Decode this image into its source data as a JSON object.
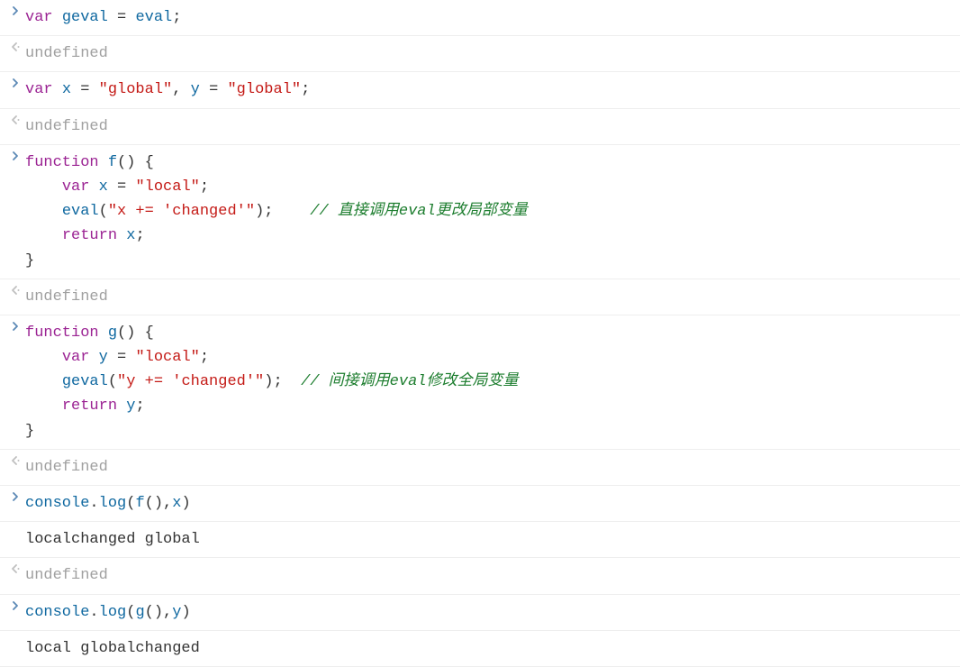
{
  "undefined_label": "undefined",
  "entries": [
    {
      "type": "input",
      "tokens": [
        {
          "cls": "kw",
          "t": "var"
        },
        {
          "cls": "plain",
          "t": " "
        },
        {
          "cls": "ident",
          "t": "geval"
        },
        {
          "cls": "plain",
          "t": " "
        },
        {
          "cls": "op",
          "t": "="
        },
        {
          "cls": "plain",
          "t": " "
        },
        {
          "cls": "ident",
          "t": "eval"
        },
        {
          "cls": "op",
          "t": ";"
        }
      ]
    },
    {
      "type": "output-undefined"
    },
    {
      "type": "input",
      "tokens": [
        {
          "cls": "kw",
          "t": "var"
        },
        {
          "cls": "plain",
          "t": " "
        },
        {
          "cls": "ident",
          "t": "x"
        },
        {
          "cls": "plain",
          "t": " "
        },
        {
          "cls": "op",
          "t": "="
        },
        {
          "cls": "plain",
          "t": " "
        },
        {
          "cls": "str",
          "t": "\"global\""
        },
        {
          "cls": "op",
          "t": ","
        },
        {
          "cls": "plain",
          "t": " "
        },
        {
          "cls": "ident",
          "t": "y"
        },
        {
          "cls": "plain",
          "t": " "
        },
        {
          "cls": "op",
          "t": "="
        },
        {
          "cls": "plain",
          "t": " "
        },
        {
          "cls": "str",
          "t": "\"global\""
        },
        {
          "cls": "op",
          "t": ";"
        }
      ]
    },
    {
      "type": "output-undefined"
    },
    {
      "type": "input",
      "tokens": [
        {
          "cls": "kw",
          "t": "function"
        },
        {
          "cls": "plain",
          "t": " "
        },
        {
          "cls": "ident",
          "t": "f"
        },
        {
          "cls": "op",
          "t": "()"
        },
        {
          "cls": "plain",
          "t": " "
        },
        {
          "cls": "op",
          "t": "{"
        },
        {
          "cls": "plain",
          "t": "\n    "
        },
        {
          "cls": "kw",
          "t": "var"
        },
        {
          "cls": "plain",
          "t": " "
        },
        {
          "cls": "ident",
          "t": "x"
        },
        {
          "cls": "plain",
          "t": " "
        },
        {
          "cls": "op",
          "t": "="
        },
        {
          "cls": "plain",
          "t": " "
        },
        {
          "cls": "str",
          "t": "\"local\""
        },
        {
          "cls": "op",
          "t": ";"
        },
        {
          "cls": "plain",
          "t": "\n    "
        },
        {
          "cls": "ident",
          "t": "eval"
        },
        {
          "cls": "op",
          "t": "("
        },
        {
          "cls": "str",
          "t": "\"x += 'changed'\""
        },
        {
          "cls": "op",
          "t": ");"
        },
        {
          "cls": "plain",
          "t": "    "
        },
        {
          "cls": "comment",
          "t": "// 直接调用eval更改局部变量"
        },
        {
          "cls": "plain",
          "t": "\n    "
        },
        {
          "cls": "kw",
          "t": "return"
        },
        {
          "cls": "plain",
          "t": " "
        },
        {
          "cls": "ident",
          "t": "x"
        },
        {
          "cls": "op",
          "t": ";"
        },
        {
          "cls": "plain",
          "t": "\n"
        },
        {
          "cls": "op",
          "t": "}"
        }
      ]
    },
    {
      "type": "output-undefined"
    },
    {
      "type": "input",
      "tokens": [
        {
          "cls": "kw",
          "t": "function"
        },
        {
          "cls": "plain",
          "t": " "
        },
        {
          "cls": "ident",
          "t": "g"
        },
        {
          "cls": "op",
          "t": "()"
        },
        {
          "cls": "plain",
          "t": " "
        },
        {
          "cls": "op",
          "t": "{"
        },
        {
          "cls": "plain",
          "t": "\n    "
        },
        {
          "cls": "kw",
          "t": "var"
        },
        {
          "cls": "plain",
          "t": " "
        },
        {
          "cls": "ident",
          "t": "y"
        },
        {
          "cls": "plain",
          "t": " "
        },
        {
          "cls": "op",
          "t": "="
        },
        {
          "cls": "plain",
          "t": " "
        },
        {
          "cls": "str",
          "t": "\"local\""
        },
        {
          "cls": "op",
          "t": ";"
        },
        {
          "cls": "plain",
          "t": "\n    "
        },
        {
          "cls": "ident",
          "t": "geval"
        },
        {
          "cls": "op",
          "t": "("
        },
        {
          "cls": "str",
          "t": "\"y += 'changed'\""
        },
        {
          "cls": "op",
          "t": ");"
        },
        {
          "cls": "plain",
          "t": "  "
        },
        {
          "cls": "comment",
          "t": "// 间接调用eval修改全局变量"
        },
        {
          "cls": "plain",
          "t": "\n    "
        },
        {
          "cls": "kw",
          "t": "return"
        },
        {
          "cls": "plain",
          "t": " "
        },
        {
          "cls": "ident",
          "t": "y"
        },
        {
          "cls": "op",
          "t": ";"
        },
        {
          "cls": "plain",
          "t": "\n"
        },
        {
          "cls": "op",
          "t": "}"
        }
      ]
    },
    {
      "type": "output-undefined"
    },
    {
      "type": "input",
      "tokens": [
        {
          "cls": "ident",
          "t": "console"
        },
        {
          "cls": "op",
          "t": "."
        },
        {
          "cls": "ident",
          "t": "log"
        },
        {
          "cls": "op",
          "t": "("
        },
        {
          "cls": "ident",
          "t": "f"
        },
        {
          "cls": "op",
          "t": "(),"
        },
        {
          "cls": "ident",
          "t": "x"
        },
        {
          "cls": "op",
          "t": ")"
        }
      ]
    },
    {
      "type": "log",
      "text": "localchanged global"
    },
    {
      "type": "output-undefined"
    },
    {
      "type": "input",
      "tokens": [
        {
          "cls": "ident",
          "t": "console"
        },
        {
          "cls": "op",
          "t": "."
        },
        {
          "cls": "ident",
          "t": "log"
        },
        {
          "cls": "op",
          "t": "("
        },
        {
          "cls": "ident",
          "t": "g"
        },
        {
          "cls": "op",
          "t": "(),"
        },
        {
          "cls": "ident",
          "t": "y"
        },
        {
          "cls": "op",
          "t": ")"
        }
      ]
    },
    {
      "type": "log",
      "text": "local globalchanged"
    }
  ]
}
